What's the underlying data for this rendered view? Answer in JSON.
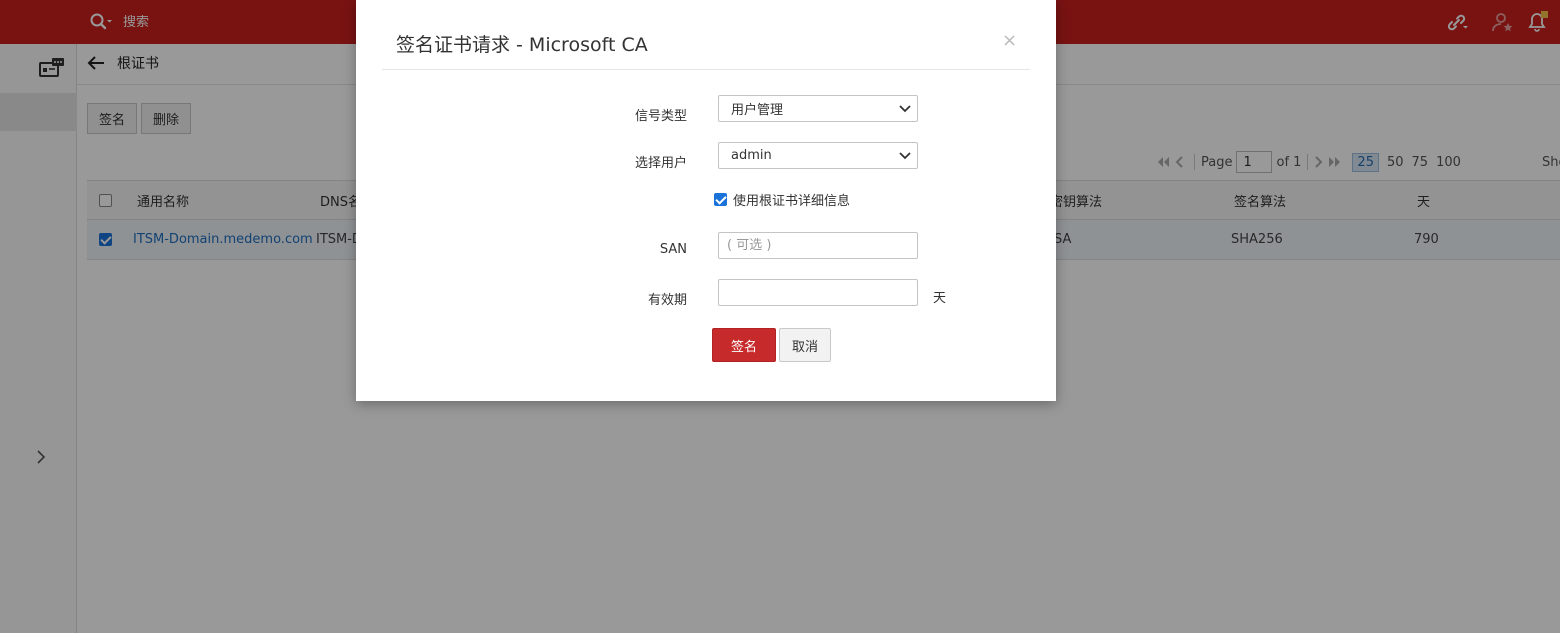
{
  "header": {
    "search_placeholder": "搜索",
    "icons": [
      "search-icon",
      "link-icon",
      "user-star-icon",
      "bell-icon"
    ]
  },
  "page": {
    "title": "根证书",
    "buttons": {
      "sign": "签名",
      "delete": "删除"
    }
  },
  "pager": {
    "page_label": "Page",
    "page_value": "1",
    "of_label": "of 1",
    "sizes": [
      "25",
      "50",
      "75",
      "100"
    ],
    "active_size": "25",
    "show_label": "Sho"
  },
  "table": {
    "headers": [
      "通用名称",
      "DNS名",
      "密钥算法",
      "签名算法",
      "天"
    ],
    "rows": [
      {
        "checked": true,
        "common_name": "ITSM-Domain.medemo.com",
        "dns": "ITSM-D",
        "key_algo": "SA",
        "sign_algo": "SHA256",
        "days": "790"
      }
    ]
  },
  "modal": {
    "title": "签名证书请求 - Microsoft CA",
    "close": "×",
    "fields": {
      "signer_type_label": "信号类型",
      "signer_type_value": "用户管理",
      "user_label": "选择用户",
      "user_value": "admin",
      "use_root_details": "使用根证书详细信息",
      "use_root_checked": true,
      "san_label": "SAN",
      "san_placeholder": "( 可选 )",
      "validity_label": "有效期",
      "validity_value": "",
      "validity_unit": "天"
    },
    "buttons": {
      "sign": "签名",
      "cancel": "取消"
    }
  },
  "colors": {
    "brand": "#c8201f",
    "primary_button": "#c72a2a",
    "link": "#1f6fbf",
    "checkbox": "#1a73d9"
  }
}
